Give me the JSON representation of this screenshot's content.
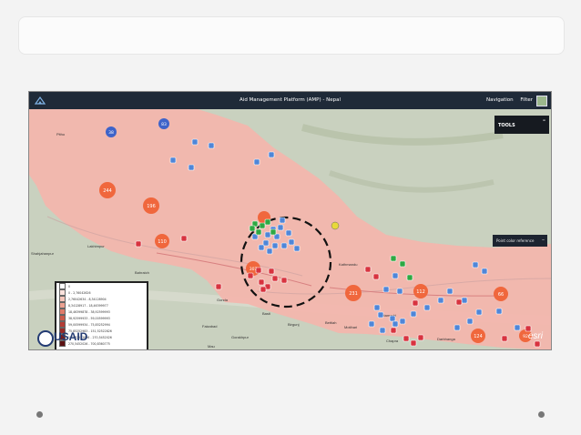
{
  "topbar": {
    "title": "Aid Management Platform (AMP) - Nepal",
    "nav_label": "Navigation",
    "filter_label": "Filter"
  },
  "tools": {
    "label": "TOOLS"
  },
  "point_color_reference": {
    "label": "Point color reference"
  },
  "legend": {
    "rows": [
      {
        "label": "0",
        "color": "#ffffff"
      },
      {
        "label": "0 - 2,76042626",
        "color": "#fbe2dc"
      },
      {
        "label": "2,76042634 - 8,34128904",
        "color": "#f6c6ba"
      },
      {
        "label": "8,34128917 - 18,46399977",
        "color": "#eca191"
      },
      {
        "label": "18,46399878 - 38,92599993",
        "color": "#df7b6a"
      },
      {
        "label": "38,92599933 - 59,00599993",
        "color": "#cc5a4a"
      },
      {
        "label": "59,00599934 - 75,85252994",
        "color": "#b33c35"
      },
      {
        "label": "75,85252983 - 151,52522826",
        "color": "#972a28"
      },
      {
        "label": "151,52522826 - 270,5452026",
        "color": "#7a1d1c"
      },
      {
        "label": "270,5452026 - 700,8360775",
        "color": "#5c1213"
      }
    ]
  },
  "logos": {
    "usaid": "USAID",
    "esri": "esri"
  },
  "place_labels": {
    "pithoragarh": "Pitho",
    "shahjahanpur": "Shahjahanpur",
    "lakhimpur": "Lakhimpur",
    "bahraich": "Bahraich",
    "gonda": "Gonda",
    "faizabad": "Faizabad",
    "gorakhpur": "Gorakhpur",
    "basti": "Basti",
    "kathmandu": "Kathmandu",
    "bettiah": "Bettiah",
    "motihari": "Motihari",
    "sitamarhi": "Sitamarhi",
    "birganj": "Birgunj",
    "mau": "Mau",
    "chapra": "Chapra",
    "darbhanga": "Darbhanga"
  },
  "clusters": {
    "c244": "244",
    "c196": "196",
    "c110": "110",
    "c83": "83",
    "c38": "38",
    "c307": "307",
    "c231": "231",
    "c112": "112",
    "c66": "66",
    "c124": "124",
    "c92": "92"
  },
  "colors": {
    "country_fill": "#f4b5ad",
    "terrain": "#c9d1bf",
    "cluster_orange": "#f0673d",
    "cluster_blue": "#3e63c9",
    "marker_blue": "#4f86d8",
    "marker_red": "#d8333f",
    "marker_green": "#2ea843",
    "highlight_circle": "#111111"
  }
}
